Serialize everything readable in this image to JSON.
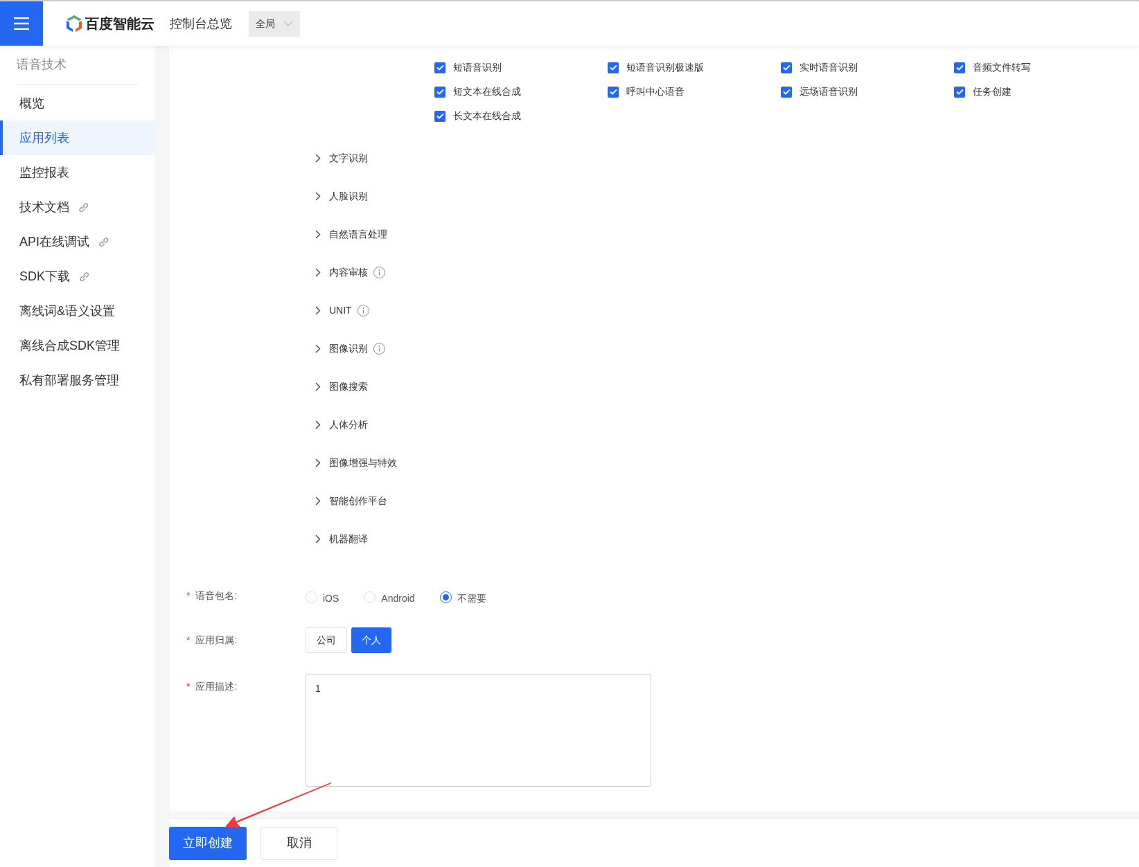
{
  "header": {
    "brand": "百度智能云",
    "nav_title": "控制台总览",
    "region_select": "全局"
  },
  "sidebar": {
    "section_title": "语音技术",
    "items": [
      {
        "label": "概览",
        "selected": false,
        "external": false
      },
      {
        "label": "应用列表",
        "selected": true,
        "external": false
      },
      {
        "label": "监控报表",
        "selected": false,
        "external": false
      },
      {
        "label": "技术文档",
        "selected": false,
        "external": true
      },
      {
        "label": "API在线调试",
        "selected": false,
        "external": true
      },
      {
        "label": "SDK下载",
        "selected": false,
        "external": true
      },
      {
        "label": "离线词&语义设置",
        "selected": false,
        "external": false
      },
      {
        "label": "离线合成SDK管理",
        "selected": false,
        "external": false
      },
      {
        "label": "私有部署服务管理",
        "selected": false,
        "external": false
      }
    ]
  },
  "api_checkboxes": [
    {
      "label": "短语音识别",
      "checked": true
    },
    {
      "label": "短语音识别极速版",
      "checked": true
    },
    {
      "label": "实时语音识别",
      "checked": true
    },
    {
      "label": "音频文件转写",
      "checked": true
    },
    {
      "label": "短文本在线合成",
      "checked": true
    },
    {
      "label": "呼叫中心语音",
      "checked": true
    },
    {
      "label": "远场语音识别",
      "checked": true
    },
    {
      "label": "任务创建",
      "checked": true
    },
    {
      "label": "长文本在线合成",
      "checked": true
    }
  ],
  "api_groups": [
    {
      "label": "文字识别",
      "expanded": false,
      "has_info": false
    },
    {
      "label": "人脸识别",
      "expanded": false,
      "has_info": false
    },
    {
      "label": "自然语言处理",
      "expanded": false,
      "has_info": false
    },
    {
      "label": "内容审核",
      "expanded": false,
      "has_info": true
    },
    {
      "label": "UNIT",
      "expanded": false,
      "has_info": true
    },
    {
      "label": "图像识别",
      "expanded": false,
      "has_info": true
    },
    {
      "label": "图像搜索",
      "expanded": false,
      "has_info": false
    },
    {
      "label": "人体分析",
      "expanded": false,
      "has_info": false
    },
    {
      "label": "图像增强与特效",
      "expanded": false,
      "has_info": false
    },
    {
      "label": "智能创作平台",
      "expanded": false,
      "has_info": false
    },
    {
      "label": "机器翻译",
      "expanded": false,
      "has_info": false
    }
  ],
  "package_name": {
    "label": "语音包名:",
    "required_mark": "*",
    "options": [
      {
        "label": "iOS",
        "selected": false
      },
      {
        "label": "Android",
        "selected": false
      },
      {
        "label": "不需要",
        "selected": true
      }
    ]
  },
  "ownership": {
    "label": "应用归属:",
    "required_mark": "*",
    "options": [
      {
        "label": "公司",
        "selected": false
      },
      {
        "label": "个人",
        "selected": true
      }
    ]
  },
  "description": {
    "label": "应用描述:",
    "required_mark": "*",
    "value": "1"
  },
  "actions": {
    "create": "立即创建",
    "cancel": "取消"
  }
}
